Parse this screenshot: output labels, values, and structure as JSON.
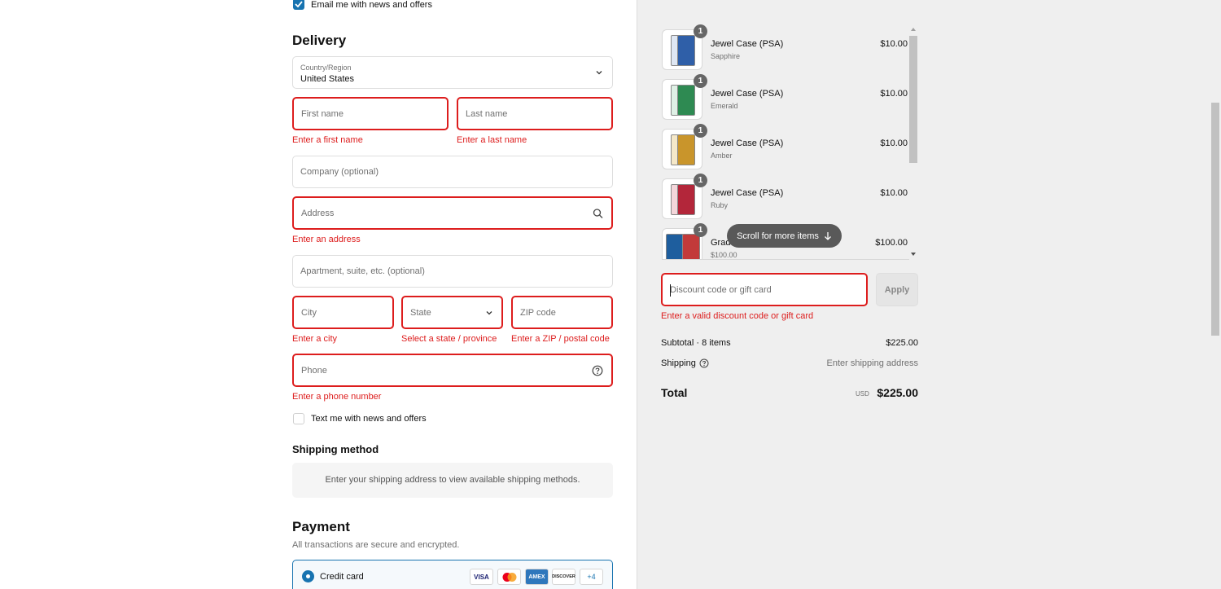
{
  "contact": {
    "email_opt_in_label": "Email me with news and offers"
  },
  "delivery": {
    "heading": "Delivery",
    "country_label": "Country/Region",
    "country_value": "United States",
    "first_name_placeholder": "First name",
    "first_name_error": "Enter a first name",
    "last_name_placeholder": "Last name",
    "last_name_error": "Enter a last name",
    "company_placeholder": "Company (optional)",
    "address_placeholder": "Address",
    "address_error": "Enter an address",
    "apartment_placeholder": "Apartment, suite, etc. (optional)",
    "city_placeholder": "City",
    "city_error": "Enter a city",
    "state_placeholder": "State",
    "state_error": "Select a state / province",
    "zip_placeholder": "ZIP code",
    "zip_error": "Enter a ZIP / postal code",
    "phone_placeholder": "Phone",
    "phone_error": "Enter a phone number",
    "sms_opt_in_label": "Text me with news and offers"
  },
  "shipping_method": {
    "heading": "Shipping method",
    "message": "Enter your shipping address to view available shipping methods."
  },
  "payment": {
    "heading": "Payment",
    "subtitle": "All transactions are secure and encrypted.",
    "option_label": "Credit card",
    "card_logos": [
      "VISA",
      "MC",
      "AMEX",
      "DISCOVER"
    ],
    "more_cards": "+4"
  },
  "cart": {
    "items": [
      {
        "name": "Jewel Case (PSA)",
        "variant": "Sapphire",
        "price": "$10.00",
        "qty": "1",
        "color": "#2f5fa8"
      },
      {
        "name": "Jewel Case (PSA)",
        "variant": "Emerald",
        "price": "$10.00",
        "qty": "1",
        "color": "#2e8a52"
      },
      {
        "name": "Jewel Case (PSA)",
        "variant": "Amber",
        "price": "$10.00",
        "qty": "1",
        "color": "#c9952b"
      },
      {
        "name": "Jewel Case (PSA)",
        "variant": "Ruby",
        "price": "$10.00",
        "qty": "1",
        "color": "#b3263a"
      },
      {
        "name": "Grad",
        "variant": "$100.00",
        "price": "$100.00",
        "qty": "1",
        "color": "#1e5e9e"
      }
    ],
    "scroll_hint": "Scroll for more items",
    "discount_placeholder": "Discount code or gift card",
    "discount_error": "Enter a valid discount code or gift card",
    "apply_label": "Apply",
    "subtotal_label": "Subtotal · 8 items",
    "subtotal_value": "$225.00",
    "shipping_label": "Shipping",
    "shipping_value": "Enter shipping address",
    "total_label": "Total",
    "currency": "USD",
    "total_value": "$225.00"
  }
}
